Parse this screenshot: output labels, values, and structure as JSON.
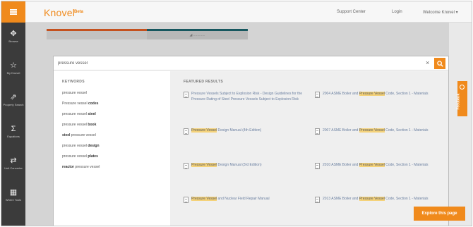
{
  "header": {
    "brand": "Knovel",
    "brand_tag": "Beta",
    "support_label": "Support Center",
    "login_label": "Login",
    "welcome_label": "Welcome Knovel ▾"
  },
  "sidebar": {
    "items": [
      {
        "icon": "browse-icon",
        "glyph": "✥",
        "label": "Browse"
      },
      {
        "icon": "star-icon",
        "glyph": "☆",
        "label": "My Knovel"
      },
      {
        "icon": "property-icon",
        "glyph": "⇗",
        "label": "Property Search"
      },
      {
        "icon": "sigma-icon",
        "glyph": "Σ",
        "label": "Equations"
      },
      {
        "icon": "converter-icon",
        "glyph": "⇄",
        "label": "Unit Converter"
      },
      {
        "icon": "tools-icon",
        "glyph": "▦",
        "label": "Where Tools"
      }
    ]
  },
  "background_tabs": [
    "",
    "◢  ............"
  ],
  "search": {
    "value": "pressure vessel",
    "clear_glyph": "×"
  },
  "keywords": {
    "heading": "KEYWORDS",
    "items": [
      {
        "pre": "pressure vessel",
        "bold": "",
        "post": ""
      },
      {
        "pre": "Pressure vessel ",
        "bold": "codes",
        "post": ""
      },
      {
        "pre": "pressure vessel ",
        "bold": "steel",
        "post": ""
      },
      {
        "pre": "pressure vessel ",
        "bold": "book",
        "post": ""
      },
      {
        "pre": "",
        "bold": "steel",
        "post": " pressure vessel"
      },
      {
        "pre": "pressure vessel ",
        "bold": "design",
        "post": ""
      },
      {
        "pre": "pressure vessel ",
        "bold": "plates",
        "post": ""
      },
      {
        "pre": "",
        "bold": "reactor",
        "post": " pressure vessel"
      }
    ]
  },
  "featured": {
    "heading": "FEATURED RESULTS",
    "results": [
      {
        "pre": "",
        "hl": "",
        "post": "Pressure Vessels Subject to Explosion Risk - Design Guidelines for the Pressure Rating of Steel Pressure Vessels Subject to Explosion Risk"
      },
      {
        "pre": "2004 ASME Boiler and ",
        "hl": "Pressure Vessel",
        "post": " Code, Section 1 - Materials"
      },
      {
        "pre": "",
        "hl": "Pressure Vessel",
        "post": " Design Manual (4th Edition)"
      },
      {
        "pre": "2007 ASME Boiler and ",
        "hl": "Pressure Vessel",
        "post": " Code, Section 1 - Materials"
      },
      {
        "pre": "",
        "hl": "Pressure Vessel",
        "post": " Design Manual (3rd Edition)"
      },
      {
        "pre": "2010 ASME Boiler and ",
        "hl": "Pressure Vessel",
        "post": " Code, Section 1 - Materials"
      },
      {
        "pre": "",
        "hl": "Pressure Vessel",
        "post": " and Nuclear Field Repair Manual"
      },
      {
        "pre": "2013 ASME Boiler and ",
        "hl": "Pressure Vessel",
        "post": " Code, Section 1 - Materials"
      }
    ]
  },
  "feedback_label": "Feedback",
  "explore_label": "Explore this page",
  "colors": {
    "accent": "#f08a1c",
    "sidebar": "#3b3b3b",
    "tab_red": "#c4511f",
    "tab_teal": "#17575f"
  }
}
